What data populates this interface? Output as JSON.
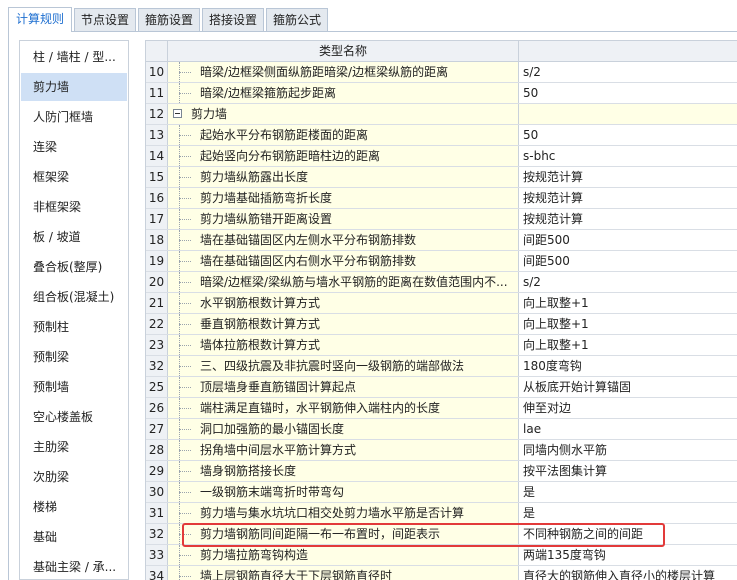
{
  "tabs": [
    {
      "label": "计算规则",
      "active": true
    },
    {
      "label": "节点设置"
    },
    {
      "label": "箍筋设置"
    },
    {
      "label": "搭接设置"
    },
    {
      "label": "箍筋公式"
    }
  ],
  "sidebar": {
    "items": [
      {
        "label": "柱 / 墙柱 / 型..."
      },
      {
        "label": "剪力墙",
        "selected": true
      },
      {
        "label": "人防门框墙"
      },
      {
        "label": "连梁"
      },
      {
        "label": "框架梁"
      },
      {
        "label": "非框架梁"
      },
      {
        "label": "板 / 坡道"
      },
      {
        "label": "叠合板(整厚)"
      },
      {
        "label": "组合板(混凝土)"
      },
      {
        "label": "预制柱"
      },
      {
        "label": "预制梁"
      },
      {
        "label": "预制墙"
      },
      {
        "label": "空心楼盖板"
      },
      {
        "label": "主肋梁"
      },
      {
        "label": "次肋梁"
      },
      {
        "label": "楼梯"
      },
      {
        "label": "基础"
      },
      {
        "label": "基础主梁 / 承..."
      }
    ]
  },
  "grid": {
    "header": {
      "name": "类型名称"
    },
    "rows": [
      {
        "num": "10",
        "name": "暗梁/边框梁侧面纵筋距暗梁/边框梁纵筋的距离",
        "value": "s/2"
      },
      {
        "num": "11",
        "name": "暗梁/边框梁箍筋起步距离",
        "value": "50"
      },
      {
        "num": "12",
        "name": "剪力墙",
        "value": "",
        "group": true
      },
      {
        "num": "13",
        "name": "起始水平分布钢筋距楼面的距离",
        "value": "50"
      },
      {
        "num": "14",
        "name": "起始竖向分布钢筋距暗柱边的距离",
        "value": "s-bhc"
      },
      {
        "num": "15",
        "name": "剪力墙纵筋露出长度",
        "value": "按规范计算"
      },
      {
        "num": "16",
        "name": "剪力墙基础插筋弯折长度",
        "value": "按规范计算"
      },
      {
        "num": "17",
        "name": "剪力墙纵筋错开距离设置",
        "value": "按规范计算"
      },
      {
        "num": "18",
        "name": "墙在基础锚固区内左侧水平分布钢筋排数",
        "value": "间距500"
      },
      {
        "num": "19",
        "name": "墙在基础锚固区内右侧水平分布钢筋排数",
        "value": "间距500"
      },
      {
        "num": "20",
        "name": "暗梁/边框梁/梁纵筋与墙水平钢筋的距离在数值范围内不...",
        "value": "s/2"
      },
      {
        "num": "21",
        "name": "水平钢筋根数计算方式",
        "value": "向上取整+1"
      },
      {
        "num": "22",
        "name": "垂直钢筋根数计算方式",
        "value": "向上取整+1"
      },
      {
        "num": "23",
        "name": "墙体拉筋根数计算方式",
        "value": "向上取整+1"
      },
      {
        "num": "32",
        "name": "三、四级抗震及非抗震时竖向一级钢筋的端部做法",
        "value": "180度弯钩"
      },
      {
        "num": "25",
        "name": "顶层墙身垂直筋锚固计算起点",
        "value": "从板底开始计算锚固"
      },
      {
        "num": "26",
        "name": "端柱满足直锚时，水平钢筋伸入端柱内的长度",
        "value": "伸至对边"
      },
      {
        "num": "27",
        "name": "洞口加强筋的最小锚固长度",
        "value": "lae"
      },
      {
        "num": "28",
        "name": "拐角墙中间层水平筋计算方式",
        "value": "同墙内侧水平筋"
      },
      {
        "num": "29",
        "name": "墙身钢筋搭接长度",
        "value": "按平法图集计算"
      },
      {
        "num": "30",
        "name": "一级钢筋末端弯折时带弯勾",
        "value": "是"
      },
      {
        "num": "31",
        "name": "剪力墙与集水坑坑口相交处剪力墙水平筋是否计算",
        "value": "是"
      },
      {
        "num": "32",
        "name": "剪力墙钢筋同间距隔一布一布置时，间距表示",
        "value": "不同种钢筋之间的间距",
        "highlight": true
      },
      {
        "num": "33",
        "name": "剪力墙拉筋弯钩构造",
        "value": "两端135度弯钩"
      },
      {
        "num": "34",
        "name": "墙上层钢筋直径大于下层钢筋直径时",
        "value": "直径大的钢筋伸入直径小的楼层计算"
      }
    ]
  },
  "colors": {
    "accent": "#1e6fd0",
    "highlight": "#e23a3a",
    "name_bg": "#ffffe6",
    "selected_bg": "#cfe0f5"
  }
}
